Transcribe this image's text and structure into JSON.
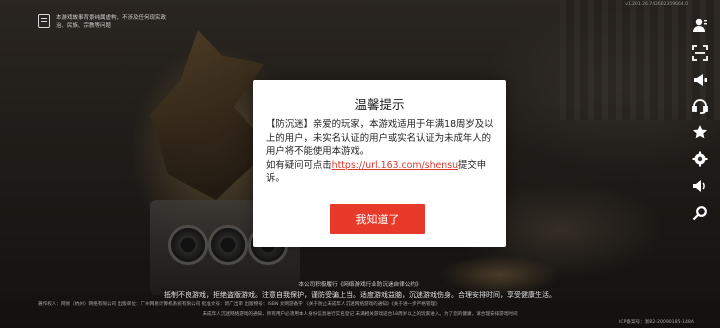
{
  "top_notice": {
    "icon": "age-rating-icon",
    "text": "本游戏故事背景纯属虚构，不涉及任何现实政治、民族、宗教等问题"
  },
  "version_text": "v1.201.26.742602359664.0",
  "sidebar": {
    "icons": [
      "user-icon",
      "scan-icon",
      "announcement-icon",
      "customer-service-icon",
      "star-icon",
      "settings-icon",
      "sound-icon",
      "search-icon"
    ]
  },
  "modal": {
    "title": "温馨提示",
    "body_prefix": "【防沉迷】亲爱的玩家，本游戏适用于年满18周岁及以上的用户，未实名认证的用户或实名认证为未成年人的用户将不能使用本游戏。",
    "body_query": "如有疑问可点击",
    "link_text": "https://url.163.com/shensu",
    "body_suffix": "提交申诉。",
    "ok_label": "我知道了"
  },
  "footer": {
    "line1": "本公司积极履行《网络游戏行业防沉迷自律公约》",
    "line2": "抵制不良游戏，拒绝盗版游戏。注意自我保护，谨防受骗上当。适度游戏益脑，沉迷游戏伤身。合理安排时间，享受健康生活。",
    "line3": "著作权人：网易（杭州）网络有限公司   出版单位：广州网易计算机系统有限公司   批准文号：新广出审   出版物号：ISBN   文网游备字   《关于防止未成年人沉迷网络游戏的通知》《关于进一步严格管理》",
    "line4": "未成年人沉迷网络游戏的通知，所有用户必须用本人身份信息进行实名登记 未满相关游戏适合18周岁以上的玩家进入。为了您的健康，请合理安排游戏时间",
    "icp": "ICP备案号：浙B2-20090185-148A"
  }
}
